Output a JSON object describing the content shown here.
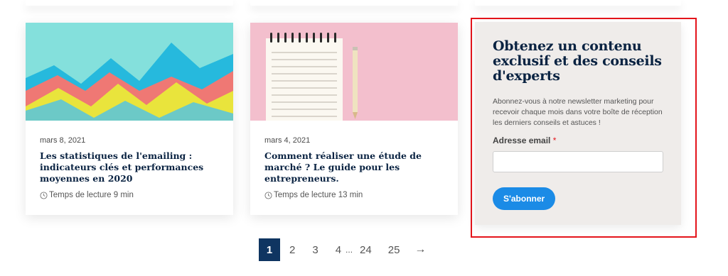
{
  "cards": [
    {
      "date": "mars 8, 2021",
      "title": "Les statistiques de l'emailing : indicateurs clés et performances moyennes en 2020",
      "reading_time": "Temps de lecture 9 min",
      "image_icon": "mountain-chart-illustration"
    },
    {
      "date": "mars 4, 2021",
      "title": "Comment réaliser une étude de marché ? Le guide pour les entrepreneurs.",
      "reading_time": "Temps de lecture 13 min",
      "image_icon": "notepad-pencil-illustration"
    }
  ],
  "newsletter": {
    "title": "Obtenez un contenu exclusif et des conseils d'experts",
    "description": "Abonnez-vous à notre newsletter marketing pour recevoir chaque mois dans votre boîte de réception les derniers conseils et astuces !",
    "email_label": "Adresse email",
    "required_mark": "*",
    "email_value": "",
    "subscribe_label": "S'abonner",
    "button_color": "#1b8be6",
    "highlight_color": "#e4141b"
  },
  "pagination": {
    "current": "1",
    "pages": [
      "2",
      "3",
      "4"
    ],
    "ellipsis": "...",
    "tail_pages": [
      "24",
      "25"
    ],
    "next": "→",
    "active_color": "#0f3561"
  }
}
